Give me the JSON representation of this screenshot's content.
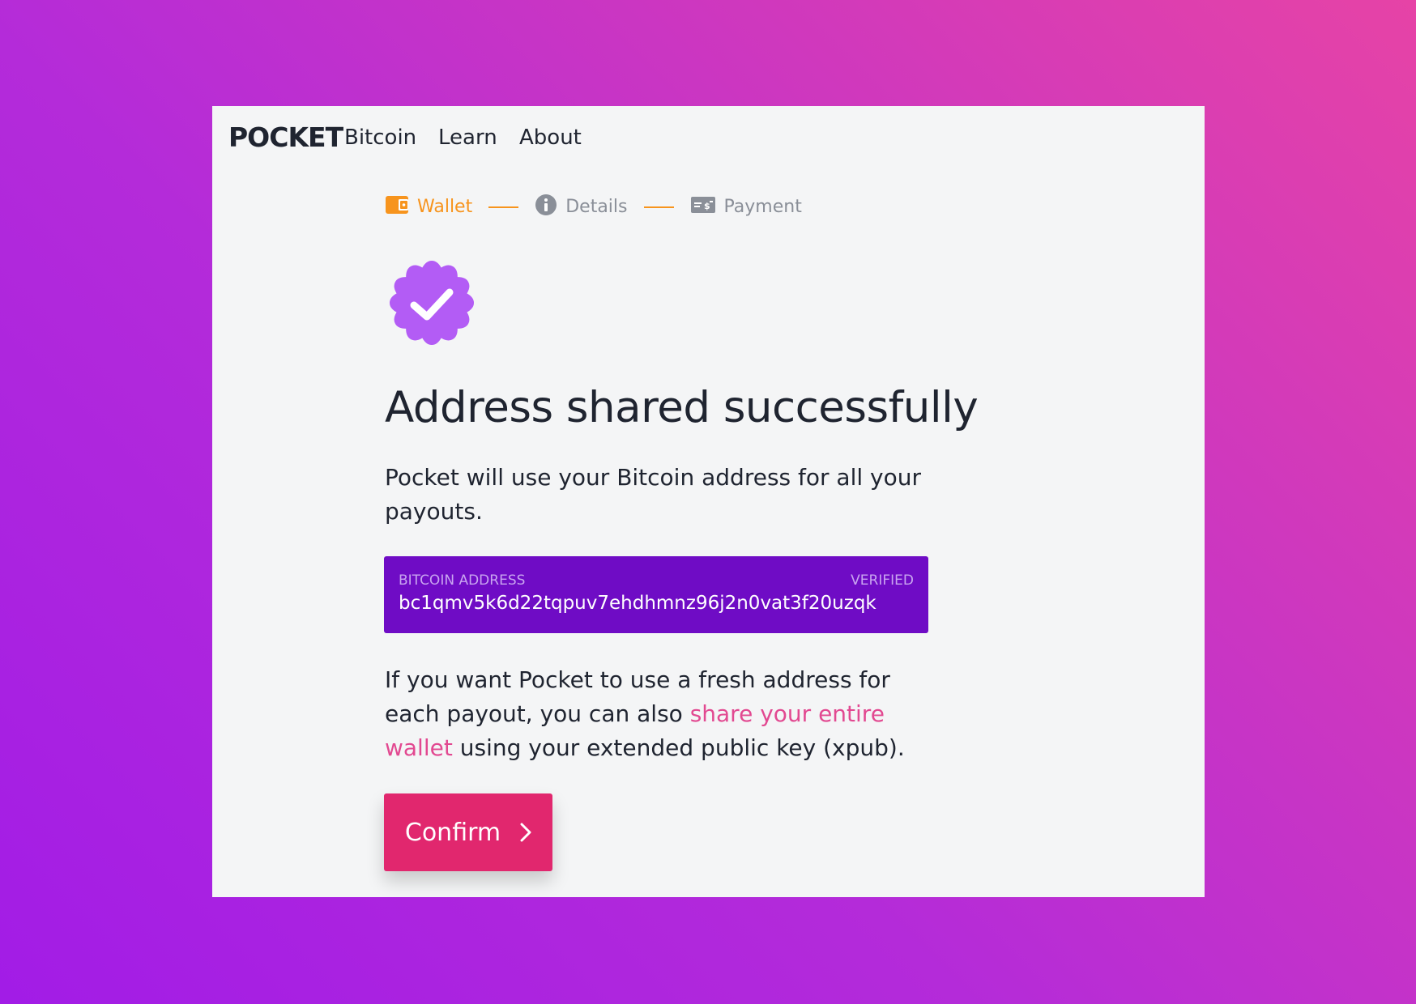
{
  "nav": {
    "logo": "POCKET",
    "links": [
      "Bitcoin",
      "Learn",
      "About"
    ]
  },
  "stepper": {
    "steps": [
      {
        "label": "Wallet",
        "icon": "wallet-icon",
        "state": "active"
      },
      {
        "label": "Details",
        "icon": "info-icon",
        "state": "inactive"
      },
      {
        "label": "Payment",
        "icon": "payment-icon",
        "state": "inactive"
      }
    ]
  },
  "badge": {
    "icon": "verified-badge-icon"
  },
  "main": {
    "title": "Address shared successfully",
    "intro": "Pocket will use your Bitcoin address for all your payouts.",
    "address": {
      "label": "BITCOIN ADDRESS",
      "status": "VERIFIED",
      "value": "bc1qmv5k6d22tqpuv7ehdhmnz96j2n0vat3f20uzqk"
    },
    "xpub_text_before": "If you want Pocket to use a fresh address for each payout, you can also ",
    "xpub_link": "share your entire wallet",
    "xpub_text_after": " using your extended public key (xpub).",
    "confirm_label": "Confirm"
  },
  "colors": {
    "accent_orange": "#f7941d",
    "badge_purple": "#b35cf5",
    "address_bg": "#6f0cc5",
    "link_pink": "#e24991",
    "button_pink": "#e1276e"
  }
}
